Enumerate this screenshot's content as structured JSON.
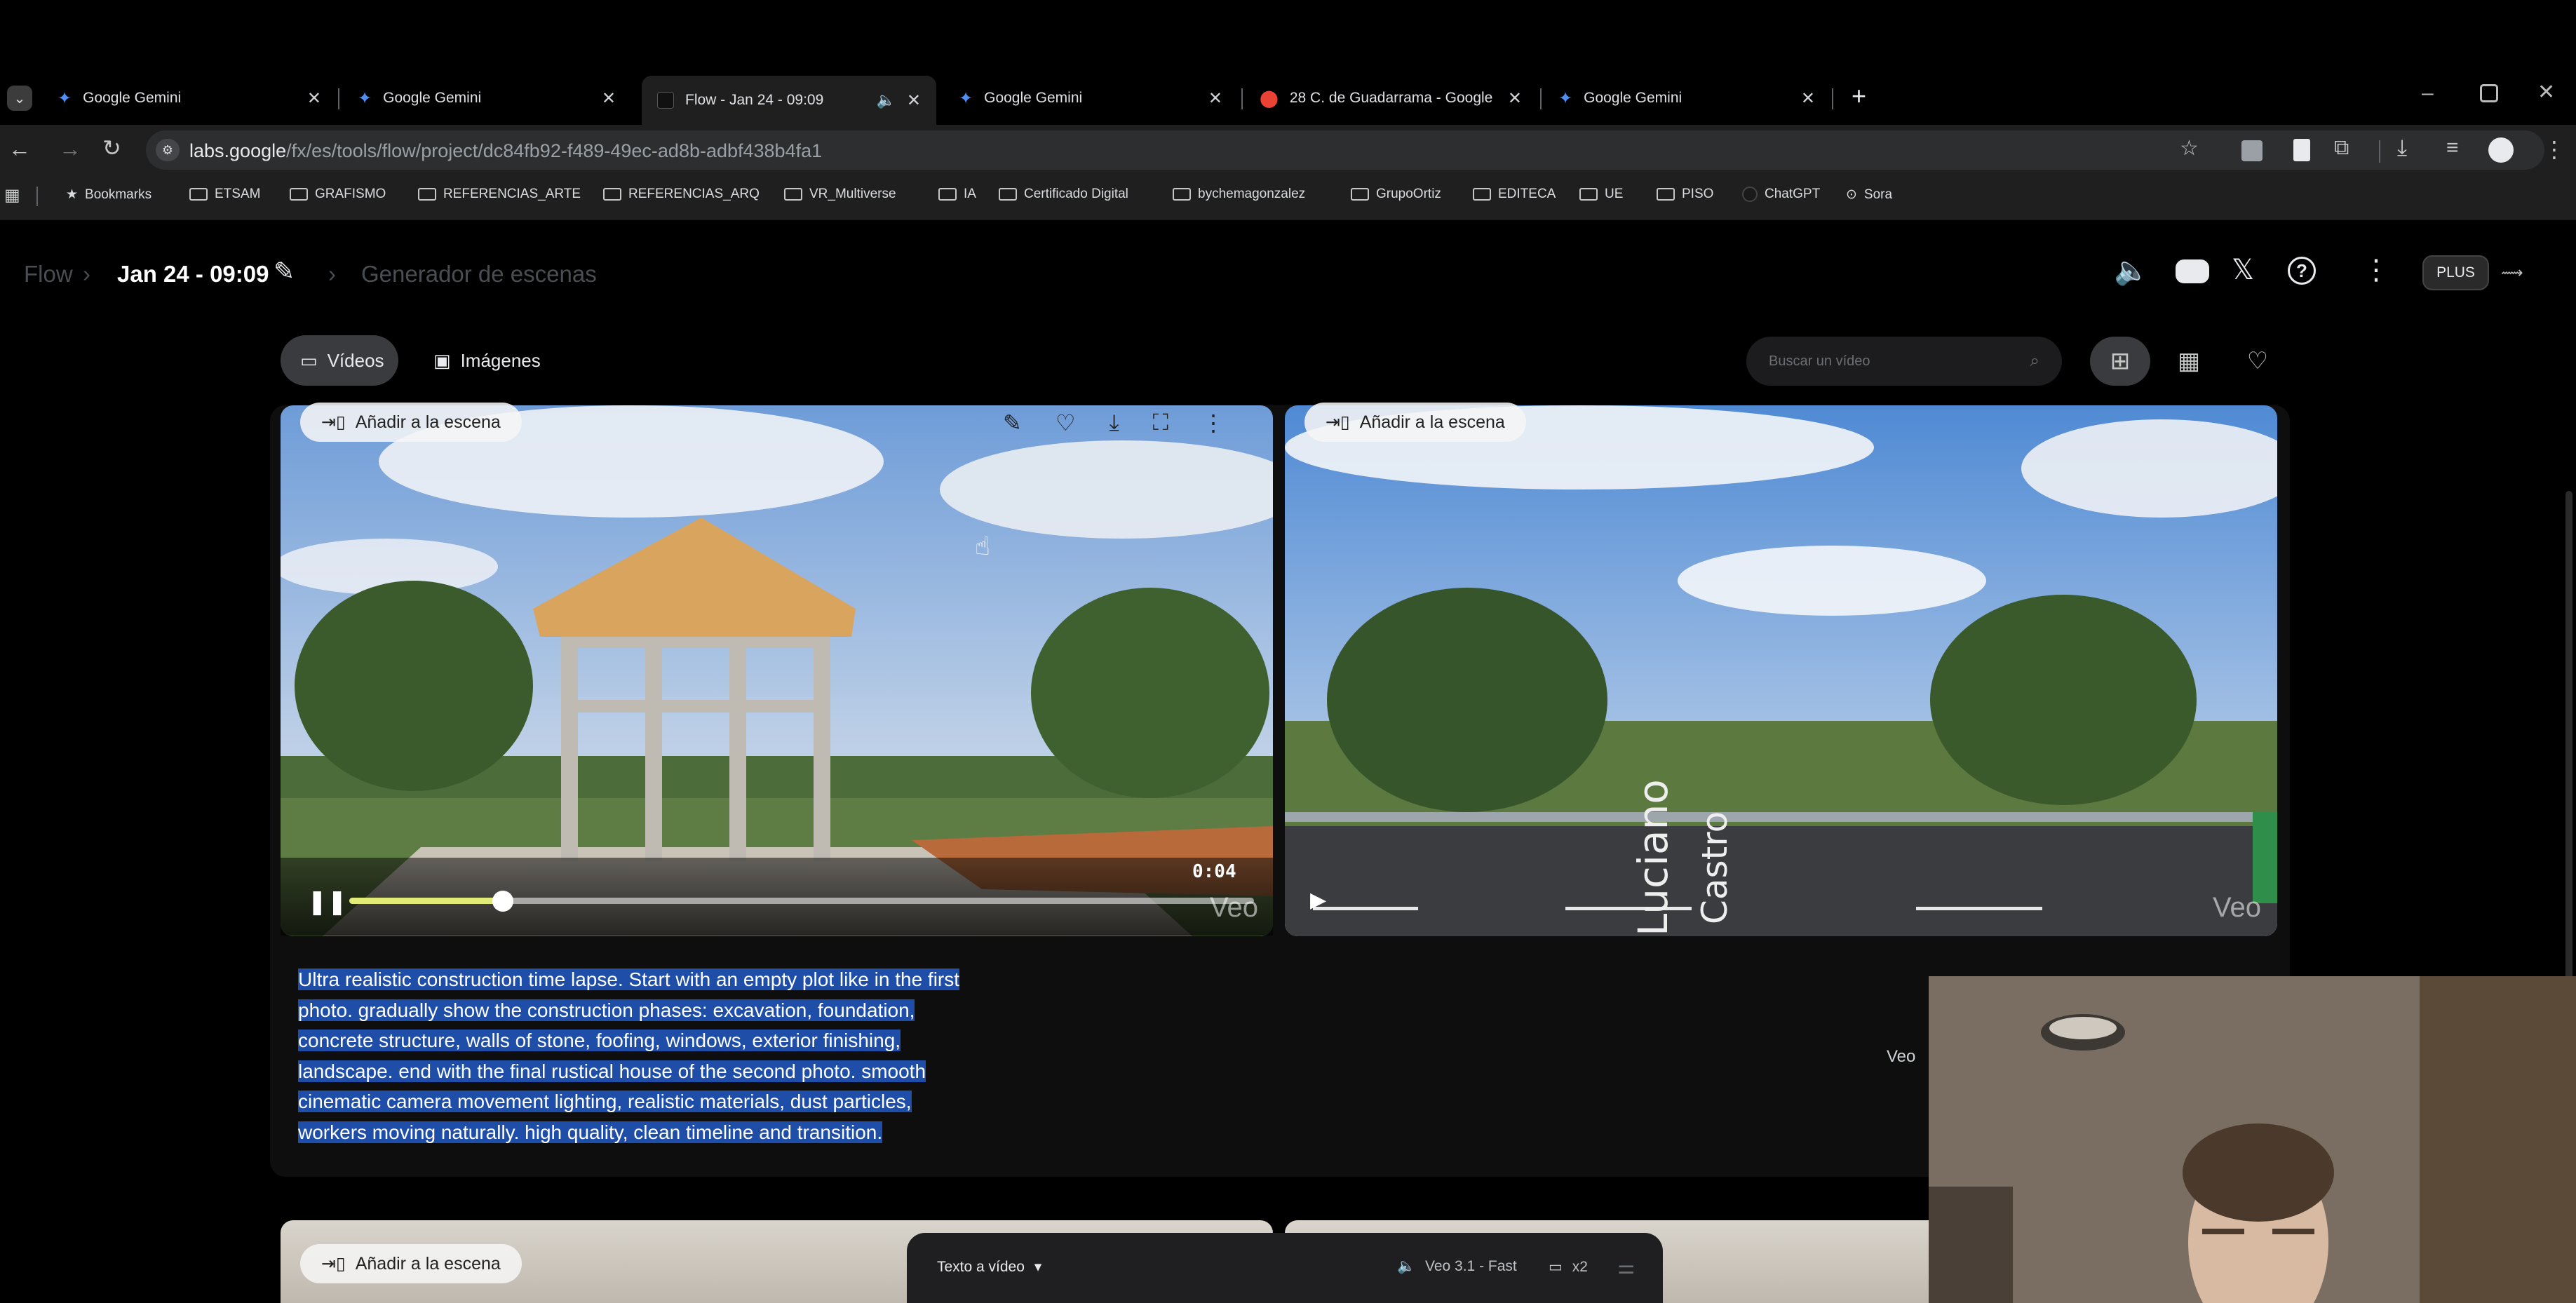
{
  "browser": {
    "tabs": [
      {
        "title": "Google Gemini",
        "active": false
      },
      {
        "title": "Google Gemini",
        "active": false
      },
      {
        "title": "Flow - Jan 24 - 09:09",
        "active": true
      },
      {
        "title": "Google Gemini",
        "active": false
      },
      {
        "title": "28 C. de Guadarrama - Google",
        "active": false
      },
      {
        "title": "Google Gemini",
        "active": false
      }
    ],
    "new_tab": "+",
    "url_host": "labs.google",
    "url_path": "/fx/es/tools/flow/project/dc84fb92-f489-49ec-ad8b-adbf438b4fa1",
    "bookmarks": [
      {
        "label": "Bookmarks",
        "icon": "star-icon"
      },
      {
        "label": "ETSAM",
        "icon": "folder-icon"
      },
      {
        "label": "GRAFISMO",
        "icon": "folder-icon"
      },
      {
        "label": "REFERENCIAS_ARTE",
        "icon": "folder-icon"
      },
      {
        "label": "REFERENCIAS_ARQ",
        "icon": "folder-icon"
      },
      {
        "label": "VR_Multiverse",
        "icon": "folder-icon"
      },
      {
        "label": "IA",
        "icon": "folder-icon"
      },
      {
        "label": "Certificado Digital",
        "icon": "folder-icon"
      },
      {
        "label": "bychemagonzalez",
        "icon": "folder-icon"
      },
      {
        "label": "GrupoOrtiz",
        "icon": "folder-icon"
      },
      {
        "label": "EDITECA",
        "icon": "folder-icon"
      },
      {
        "label": "UE",
        "icon": "folder-icon"
      },
      {
        "label": "PISO",
        "icon": "folder-icon"
      },
      {
        "label": "ChatGPT",
        "icon": "chatgpt-icon"
      },
      {
        "label": "Sora",
        "icon": "sora-icon"
      }
    ]
  },
  "header": {
    "root": "Flow",
    "project": "Jan 24 - 09:09",
    "scene": "Generador de escenas",
    "plan": "PLUS"
  },
  "filters": {
    "videos": "Vídeos",
    "images": "Imágenes",
    "search_placeholder": "Buscar un vídeo"
  },
  "clips": {
    "add_to_scene": "Añadir a la escena",
    "time": "0:04",
    "watermark": "Veo",
    "progress": 0.17,
    "road_sign_a": "Luciano",
    "road_sign_b": "Castro"
  },
  "prompt": {
    "lines": [
      "Ultra realistic construction time lapse. Start with an empty plot like in the first",
      "photo. gradually show the construction phases: excavation, foundation,",
      "concrete structure, walls of stone, foofing, windows, exterior finishing,",
      "landscape. end with the final rustical house of the second photo. smooth",
      "cinematic camera movement lighting, realistic materials, dust particles,",
      "workers moving naturally. high quality, clean timeline and transition."
    ],
    "model_label": "Veo"
  },
  "composer": {
    "mode": "Texto a vídeo",
    "model": "Veo 3.1 - Fast",
    "count": "x2"
  },
  "colors": {
    "accent_progress": "#e0ec75",
    "selection": "#1f4ea8",
    "gemini": "#4f8ff7"
  }
}
